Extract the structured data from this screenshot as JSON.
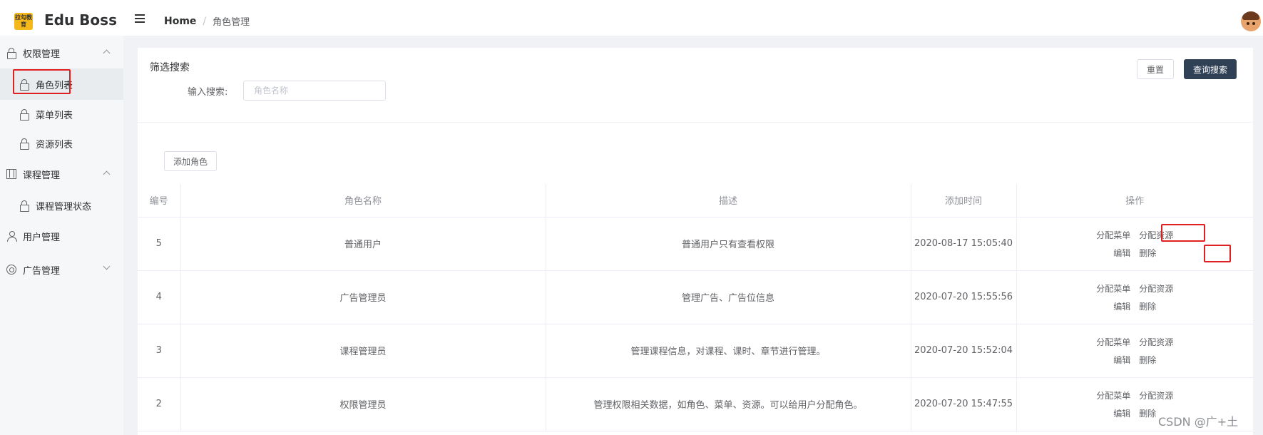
{
  "header": {
    "logo_text": "拉勾教育",
    "brand": "Edu Boss",
    "breadcrumb_home": "Home",
    "breadcrumb_sep": "/",
    "breadcrumb_current": "角色管理"
  },
  "sidebar": {
    "items": [
      {
        "label": "权限管理",
        "icon": "lock-icon",
        "expanded": true
      },
      {
        "label": "角色列表",
        "icon": "lock-icon",
        "active": true
      },
      {
        "label": "菜单列表",
        "icon": "lock-icon"
      },
      {
        "label": "资源列表",
        "icon": "lock-icon"
      },
      {
        "label": "课程管理",
        "icon": "grid-icon",
        "expanded": true
      },
      {
        "label": "课程管理状态",
        "icon": "lock-icon"
      },
      {
        "label": "用户管理",
        "icon": "user-icon"
      },
      {
        "label": "广告管理",
        "icon": "gear-icon",
        "expanded": false
      }
    ]
  },
  "filter": {
    "title": "筛选搜索",
    "label": "输入搜索:",
    "placeholder": "角色名称",
    "reset": "重置",
    "query": "查询搜索"
  },
  "toolbar": {
    "add": "添加角色"
  },
  "table": {
    "headers": [
      "编号",
      "角色名称",
      "描述",
      "添加时间",
      "操作"
    ],
    "rows": [
      {
        "id": "5",
        "name": "普通用户",
        "desc": "普通用户只有查看权限",
        "time": "2020-08-17 15:05:40"
      },
      {
        "id": "4",
        "name": "广告管理员",
        "desc": "管理广告、广告位信息",
        "time": "2020-07-20 15:55:56"
      },
      {
        "id": "3",
        "name": "课程管理员",
        "desc": "管理课程信息，对课程、课时、章节进行管理。",
        "time": "2020-07-20 15:52:04"
      },
      {
        "id": "2",
        "name": "权限管理员",
        "desc": "管理权限相关数据，如角色、菜单、资源。可以给用户分配角色。",
        "time": "2020-07-20 15:47:55"
      }
    ],
    "actions": {
      "assign_menu": "分配菜单",
      "assign_resource": "分配资源",
      "edit": "编辑",
      "delete": "删除"
    }
  },
  "watermark": "CSDN @广+土",
  "colors": {
    "primary_button": "#304156",
    "highlight_box": "#e02020",
    "sidebar_bg": "#f6f7f9"
  }
}
